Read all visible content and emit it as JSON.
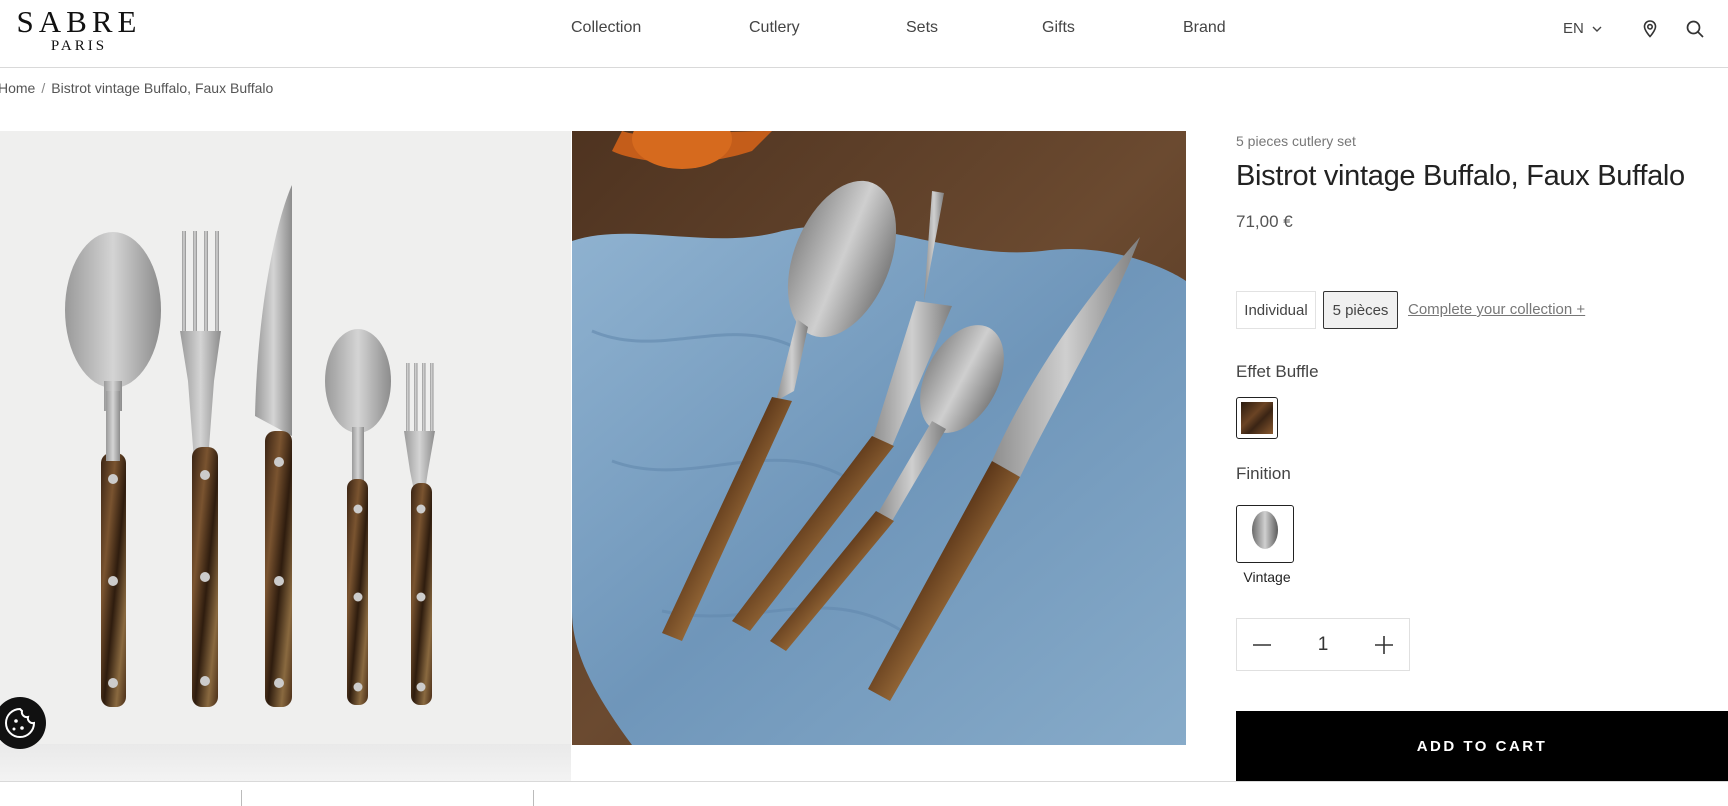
{
  "header": {
    "logo": {
      "main": "SABRE",
      "sub": "PARIS"
    },
    "nav": [
      "Collection",
      "Cutlery",
      "Sets",
      "Gifts",
      "Brand"
    ],
    "language": "EN",
    "icons": [
      "chevron-down-icon",
      "location-pin-icon",
      "search-icon"
    ]
  },
  "breadcrumb": {
    "home": "Home",
    "separator": "/",
    "current": "Bistrot vintage Buffalo, Faux Buffalo"
  },
  "product": {
    "subtitle": "5 pieces cutlery set",
    "title": "Bistrot vintage Buffalo, Faux Buffalo",
    "price": "71,00 €",
    "options": [
      "Individual",
      "5 pièces"
    ],
    "selected_option": "5 pièces",
    "collection_link": "Complete your collection +",
    "color_label": "Effet Buffle",
    "finish_label": "Finition",
    "finish_name": "Vintage",
    "quantity": "1",
    "add_to_cart": "ADD TO CART"
  },
  "colors": {
    "accent": "#000000",
    "handle_brown": "#6b4424",
    "napkin_blue": "#7fa3c4",
    "steel": "#b8b8b8"
  }
}
